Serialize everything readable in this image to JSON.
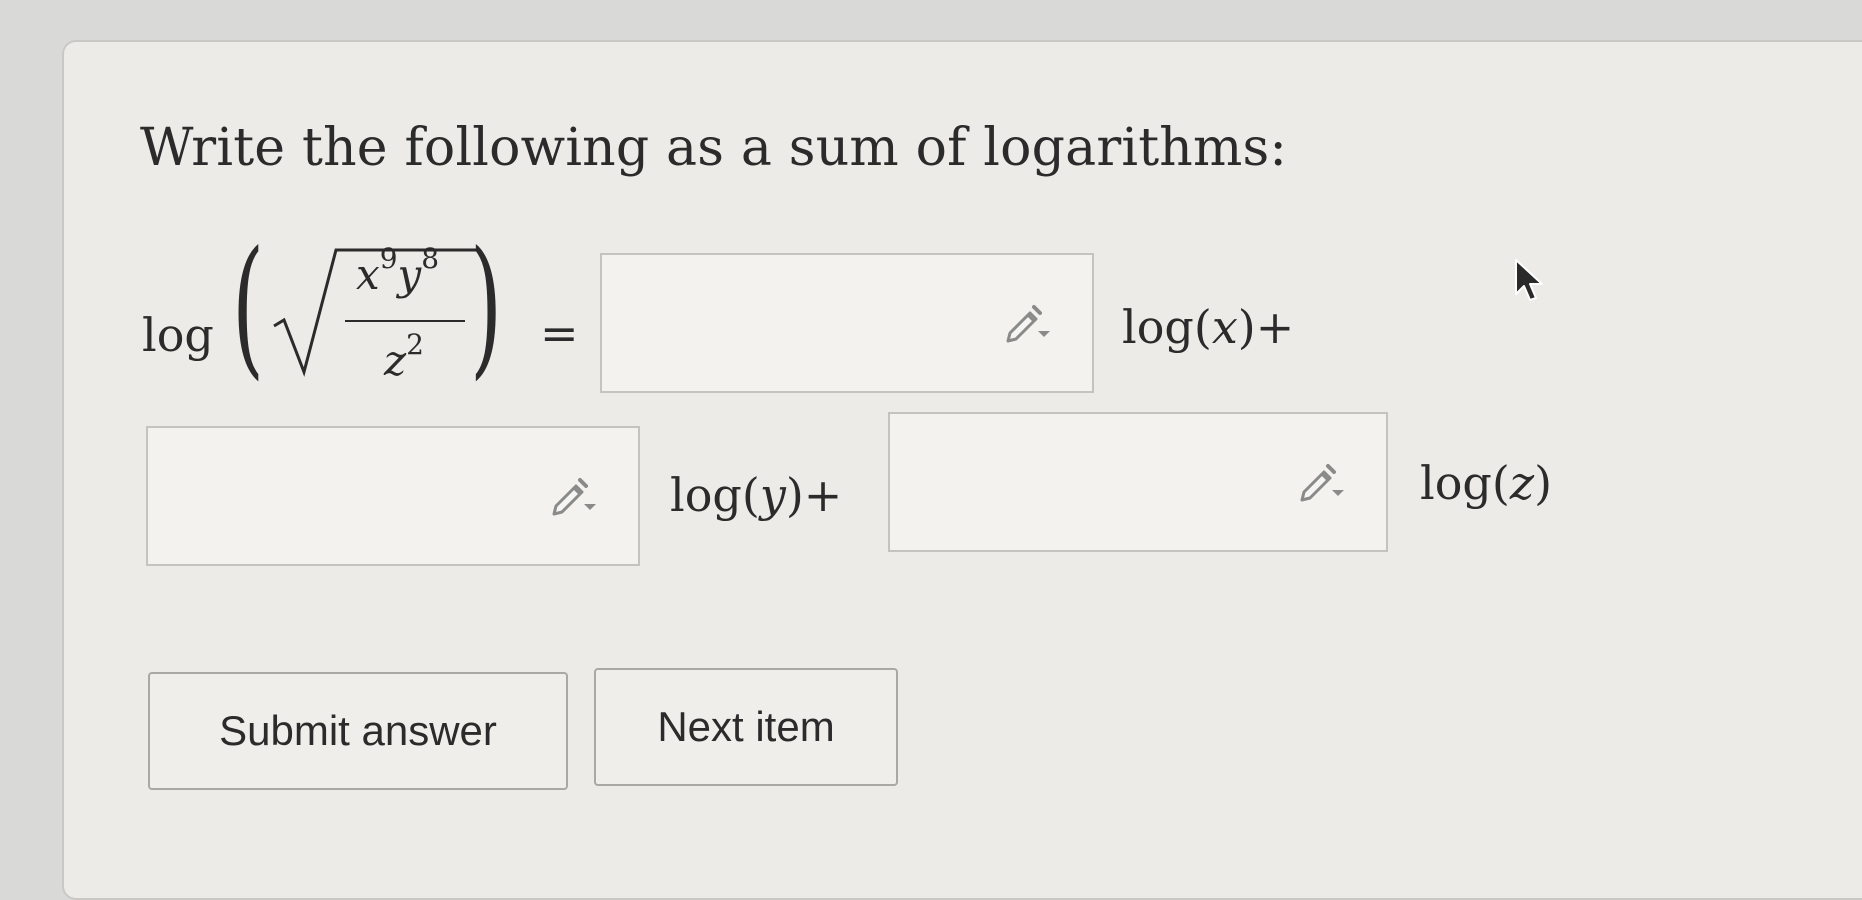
{
  "question": {
    "prompt": "Write the following as a sum of logarithms:"
  },
  "expression": {
    "log_word": "log",
    "numerator_x": "x",
    "numerator_x_exp": "9",
    "numerator_y": "y",
    "numerator_y_exp": "8",
    "denominator_z": "z",
    "denominator_z_exp": "2",
    "equals": "="
  },
  "answers": [
    {
      "value": "",
      "term_prefix": "log(",
      "variable": "x",
      "term_suffix": ")+"
    },
    {
      "value": "",
      "term_prefix": "log(",
      "variable": "y",
      "term_suffix": ")+"
    },
    {
      "value": "",
      "term_prefix": "log(",
      "variable": "z",
      "term_suffix": ")"
    }
  ],
  "buttons": {
    "submit_label": "Submit answer",
    "next_label": "Next item"
  },
  "icons": {
    "answer_tool": "pencil-dropdown-icon",
    "pointer": "mouse-cursor-icon"
  }
}
